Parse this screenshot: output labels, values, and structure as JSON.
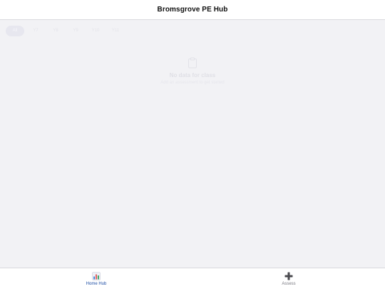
{
  "header": {
    "title": "Bromsgrove PE Hub"
  },
  "tabs": [
    {
      "label": "All",
      "active": true
    },
    {
      "label": "Y7",
      "active": false
    },
    {
      "label": "Y8",
      "active": false
    },
    {
      "label": "Y9",
      "active": false
    },
    {
      "label": "Y10",
      "active": false
    },
    {
      "label": "Y11",
      "active": false
    }
  ],
  "empty_state": {
    "icon": "clipboard-icon",
    "title": "No data for class",
    "subtitle": "Add an assessment to get started"
  },
  "bottom_nav": {
    "items": [
      {
        "label": "Home Hub",
        "icon": "bar-chart-icon",
        "active": true
      },
      {
        "label": "Assess",
        "icon": "plus-icon",
        "active": false
      }
    ]
  },
  "colors": {
    "accent": "#1f4fa6",
    "background": "#f2f2f5",
    "header_bg": "#ffffff",
    "plus_icon": "#4a4a4f"
  }
}
